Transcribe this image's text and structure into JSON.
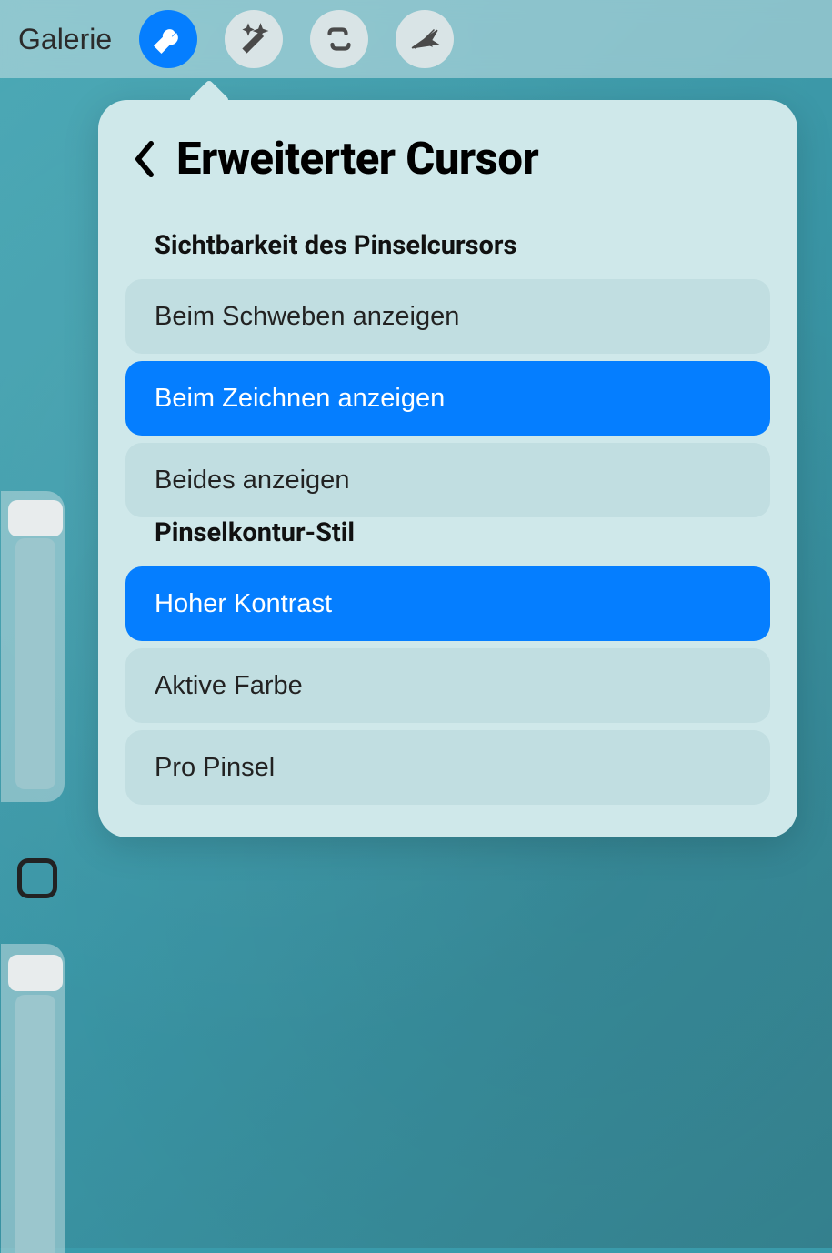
{
  "toolbar": {
    "gallery_label": "Galerie",
    "icons": {
      "wrench": "wrench-icon",
      "wand": "magic-wand-icon",
      "select": "selection-icon",
      "move": "arrow-pointer-icon"
    }
  },
  "popover": {
    "title": "Erweiterter Cursor",
    "sections": [
      {
        "title": "Sichtbarkeit des Pinselcursors",
        "options": [
          {
            "label": "Beim Schweben anzeigen",
            "selected": false
          },
          {
            "label": "Beim Zeichnen anzeigen",
            "selected": true
          },
          {
            "label": "Beides anzeigen",
            "selected": false
          }
        ]
      },
      {
        "title": "Pinselkontur-Stil",
        "options": [
          {
            "label": "Hoher Kontrast",
            "selected": true
          },
          {
            "label": "Aktive Farbe",
            "selected": false
          },
          {
            "label": "Pro Pinsel",
            "selected": false
          }
        ]
      }
    ]
  },
  "colors": {
    "accent": "#057eff"
  }
}
